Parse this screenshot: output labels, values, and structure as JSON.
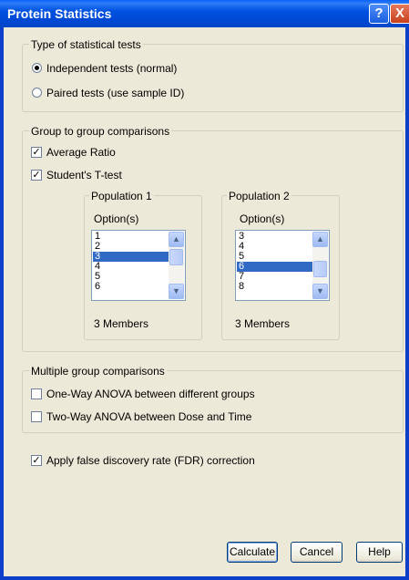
{
  "window": {
    "title": "Protein Statistics",
    "help_glyph": "?",
    "close_glyph": "X"
  },
  "test_type": {
    "legend": "Type of statistical tests",
    "options": [
      {
        "label": "Independent tests (normal)",
        "selected": true
      },
      {
        "label": "Paired tests (use sample ID)",
        "selected": false
      }
    ]
  },
  "group_to_group": {
    "legend": "Group to group comparisons",
    "average_ratio": {
      "label": "Average Ratio",
      "checked": true
    },
    "t_test": {
      "label": "Student's T-test",
      "checked": true
    },
    "population1": {
      "legend": "Population 1",
      "options_label": "Option(s)",
      "items": [
        "1",
        "2",
        "3",
        "4",
        "5",
        "6"
      ],
      "selected": "3",
      "members": "3 Members"
    },
    "population2": {
      "legend": "Population 2",
      "options_label": "Option(s)",
      "items": [
        "3",
        "4",
        "5",
        "6",
        "7",
        "8"
      ],
      "selected": "6",
      "members": "3 Members"
    }
  },
  "multiple_group": {
    "legend": "Multiple group comparisons",
    "one_way": {
      "label": "One-Way ANOVA between different groups",
      "checked": false
    },
    "two_way": {
      "label": "Two-Way ANOVA between Dose and Time",
      "checked": false
    }
  },
  "fdr": {
    "label": "Apply false discovery rate (FDR) correction",
    "checked": true
  },
  "buttons": {
    "calculate": "Calculate",
    "cancel": "Cancel",
    "help": "Help"
  },
  "glyphs": {
    "check": "✓",
    "up": "▲",
    "down": "▼"
  },
  "colors": {
    "titlebar": "#0052e0",
    "selection": "#316ac5",
    "dialog_bg": "#ece9d8"
  }
}
